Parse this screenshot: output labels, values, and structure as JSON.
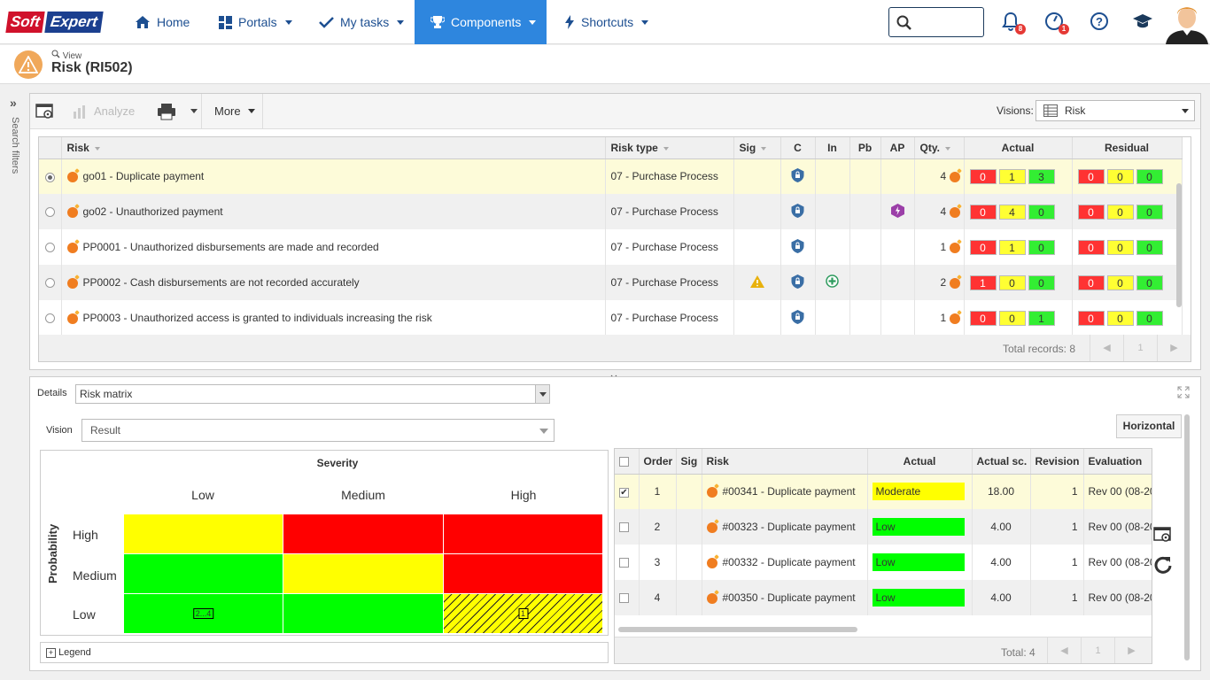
{
  "logo": {
    "part1": "Soft",
    "part2": "Expert"
  },
  "nav": {
    "home": "Home",
    "portals": "Portals",
    "my_tasks": "My tasks",
    "components": "Components",
    "shortcuts": "Shortcuts"
  },
  "notifications": {
    "bell_count": "8",
    "timer_count": "1"
  },
  "header": {
    "view_label": "View",
    "title": "Risk (RI502)"
  },
  "sidebar": {
    "label": "Search filters"
  },
  "toolbar": {
    "analyze": "Analyze",
    "more": "More",
    "visions_label": "Visions:",
    "visions_value": "Risk"
  },
  "grid": {
    "columns": [
      "Risk",
      "Risk type",
      "Sig",
      "C",
      "In",
      "Pb",
      "AP",
      "Qty.",
      "Actual",
      "Residual"
    ],
    "rows": [
      {
        "risk": "go01 - Duplicate payment",
        "type": "07 - Purchase Process",
        "sig": "",
        "in": "",
        "ap": "",
        "qty": "4",
        "actual": [
          "0",
          "1",
          "3"
        ],
        "residual": [
          "0",
          "0",
          "0"
        ]
      },
      {
        "risk": "go02 - Unauthorized payment",
        "type": "07 - Purchase Process",
        "sig": "",
        "in": "",
        "ap": "ap",
        "qty": "4",
        "actual": [
          "0",
          "4",
          "0"
        ],
        "residual": [
          "0",
          "0",
          "0"
        ]
      },
      {
        "risk": "PP0001 - Unauthorized disbursements are made and recorded",
        "type": "07 - Purchase Process",
        "sig": "",
        "in": "",
        "ap": "",
        "qty": "1",
        "actual": [
          "0",
          "1",
          "0"
        ],
        "residual": [
          "0",
          "0",
          "0"
        ]
      },
      {
        "risk": "PP0002 - Cash disbursements are not recorded accurately",
        "type": "07 - Purchase Process",
        "sig": "warn",
        "in": "in",
        "ap": "",
        "qty": "2",
        "actual": [
          "1",
          "0",
          "0"
        ],
        "residual": [
          "0",
          "0",
          "0"
        ]
      },
      {
        "risk": "PP0003 - Unauthorized access is granted to individuals increasing the risk",
        "type": "07 - Purchase Process",
        "sig": "",
        "in": "",
        "ap": "",
        "qty": "1",
        "actual": [
          "0",
          "0",
          "1"
        ],
        "residual": [
          "0",
          "0",
          "0"
        ]
      }
    ],
    "total": "Total records: 8",
    "page": "1"
  },
  "details": {
    "label": "Details",
    "value": "Risk matrix",
    "vision_label": "Vision",
    "vision_value": "Result",
    "horizontal": "Horizontal"
  },
  "matrix": {
    "title": "Severity",
    "y_label": "Probability",
    "columns": [
      "Low",
      "Medium",
      "High"
    ],
    "rows": [
      "High",
      "Medium",
      "Low"
    ],
    "colors": [
      [
        "yellow",
        "red",
        "red"
      ],
      [
        "green",
        "yellow",
        "red"
      ],
      [
        "green",
        "green",
        "yellow-hatched"
      ]
    ],
    "tags": {
      "low_low": "2...4",
      "low_high": "1"
    },
    "legend": "Legend"
  },
  "detail_grid": {
    "columns": [
      "Order",
      "Sig",
      "Risk",
      "Actual",
      "Actual sc.",
      "Revision",
      "Evaluation"
    ],
    "rows": [
      {
        "order": "1",
        "risk": "#00341 - Duplicate payment",
        "level": "Moderate",
        "color": "yellow",
        "score": "18.00",
        "revision": "1",
        "evaluation": "Rev 00 (08-20",
        "checked": true
      },
      {
        "order": "2",
        "risk": "#00323 - Duplicate payment",
        "level": "Low",
        "color": "green",
        "score": "4.00",
        "revision": "1",
        "evaluation": "Rev 00 (08-20",
        "checked": false
      },
      {
        "order": "3",
        "risk": "#00332 - Duplicate payment",
        "level": "Low",
        "color": "green",
        "score": "4.00",
        "revision": "1",
        "evaluation": "Rev 00 (08-20",
        "checked": false
      },
      {
        "order": "4",
        "risk": "#00350 - Duplicate payment",
        "level": "Low",
        "color": "green",
        "score": "4.00",
        "revision": "1",
        "evaluation": "Rev 00 (08-20",
        "checked": false
      }
    ],
    "total": "Total: 4",
    "page": "1"
  },
  "colors": {
    "brand_red": "#d0112b",
    "brand_blue": "#1b3f8f",
    "nav_active": "#2e86de",
    "nav_text": "#1d4f91"
  }
}
